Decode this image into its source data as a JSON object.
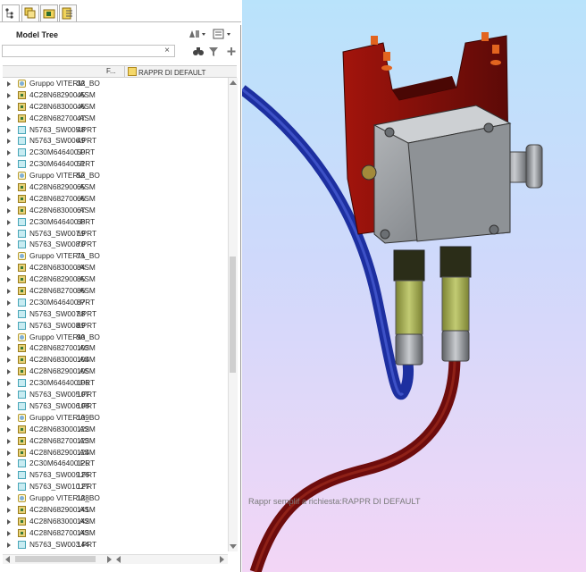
{
  "left_panel": {
    "title": "Model Tree",
    "search": {
      "value": "",
      "placeholder": "",
      "clear_icon": "×"
    },
    "columns": {
      "filename": "F...",
      "representation": "RAPPR DI DEFAULT"
    }
  },
  "tree_rows": [
    {
      "name": "Gruppo VITERIA_BO",
      "num": "32",
      "icon": "group-icon"
    },
    {
      "name": "4C28N682900.ASM",
      "num": "45",
      "icon": "assembly-icon"
    },
    {
      "name": "4C28N683000.ASM",
      "num": "46",
      "icon": "assembly-icon"
    },
    {
      "name": "4C28N682700.ASM",
      "num": "47",
      "icon": "assembly-icon"
    },
    {
      "name": "N5763_SW005.PRT",
      "num": "48",
      "icon": "part-icon"
    },
    {
      "name": "N5763_SW006.PRT",
      "num": "49",
      "icon": "part-icon"
    },
    {
      "name": "2C30M646400.PRT",
      "num": "50",
      "icon": "part-icon"
    },
    {
      "name": "2C30M646400.PRT",
      "num": "51",
      "icon": "part-icon"
    },
    {
      "name": "Gruppo VITERIA_BO",
      "num": "52",
      "icon": "group-icon"
    },
    {
      "name": "4C28N682900.ASM",
      "num": "65",
      "icon": "assembly-icon"
    },
    {
      "name": "4C28N682700.ASM",
      "num": "66",
      "icon": "assembly-icon"
    },
    {
      "name": "4C28N683000.ASM",
      "num": "67",
      "icon": "assembly-icon"
    },
    {
      "name": "2C30M646400.PRT",
      "num": "68",
      "icon": "part-icon"
    },
    {
      "name": "N5763_SW007.PRT",
      "num": "69",
      "icon": "part-icon"
    },
    {
      "name": "N5763_SW008.PRT",
      "num": "70",
      "icon": "part-icon"
    },
    {
      "name": "Gruppo VITERIA_BO",
      "num": "71",
      "icon": "group-icon"
    },
    {
      "name": "4C28N683000.ASM",
      "num": "84",
      "icon": "assembly-icon"
    },
    {
      "name": "4C28N682900.ASM",
      "num": "85",
      "icon": "assembly-icon"
    },
    {
      "name": "4C28N682700.ASM",
      "num": "86",
      "icon": "assembly-icon"
    },
    {
      "name": "2C30M646400.PRT",
      "num": "87",
      "icon": "part-icon"
    },
    {
      "name": "N5763_SW007.PRT",
      "num": "88",
      "icon": "part-icon"
    },
    {
      "name": "N5763_SW008.PRT",
      "num": "89",
      "icon": "part-icon"
    },
    {
      "name": "Gruppo VITERIA_BO",
      "num": "90",
      "icon": "group-icon"
    },
    {
      "name": "4C28N682700.ASM",
      "num": "103",
      "icon": "assembly-icon"
    },
    {
      "name": "4C28N683000.ASM",
      "num": "104",
      "icon": "assembly-icon"
    },
    {
      "name": "4C28N682900.ASM",
      "num": "105",
      "icon": "assembly-icon"
    },
    {
      "name": "2C30M646400.PRT",
      "num": "106",
      "icon": "part-icon"
    },
    {
      "name": "N5763_SW005.PRT",
      "num": "107",
      "icon": "part-icon"
    },
    {
      "name": "N5763_SW006.PRT",
      "num": "108",
      "icon": "part-icon"
    },
    {
      "name": "Gruppo VITERIA_BO",
      "num": "109",
      "icon": "group-icon"
    },
    {
      "name": "4C28N683000.ASM",
      "num": "122",
      "icon": "assembly-icon"
    },
    {
      "name": "4C28N682700.ASM",
      "num": "123",
      "icon": "assembly-icon"
    },
    {
      "name": "4C28N682900.ASM",
      "num": "124",
      "icon": "assembly-icon"
    },
    {
      "name": "2C30M646400.PRT",
      "num": "125",
      "icon": "part-icon"
    },
    {
      "name": "N5763_SW009.PRT",
      "num": "126",
      "icon": "part-icon"
    },
    {
      "name": "N5763_SW010.PRT",
      "num": "127",
      "icon": "part-icon"
    },
    {
      "name": "Gruppo VITERIA_BO",
      "num": "128",
      "icon": "group-icon"
    },
    {
      "name": "4C28N682900.ASM",
      "num": "141",
      "icon": "assembly-icon"
    },
    {
      "name": "4C28N683000.ASM",
      "num": "142",
      "icon": "assembly-icon"
    },
    {
      "name": "4C28N682700.ASM",
      "num": "143",
      "icon": "assembly-icon"
    },
    {
      "name": "N5763_SW003.PRT",
      "num": "144",
      "icon": "part-icon"
    }
  ],
  "viewport": {
    "status_text": "Rappr semplif a richiesta:RAPPR DI DEFAULT"
  },
  "colors": {
    "bracket": "#7a0f0a",
    "box": "#8e9296",
    "blue_cable": "#1d2fa0",
    "red_cable": "#6e0c0c",
    "connector": "#a5ae55"
  }
}
